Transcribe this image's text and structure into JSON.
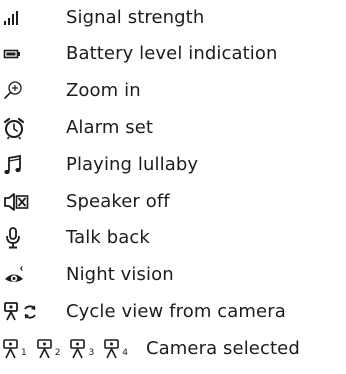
{
  "legend": {
    "items": [
      {
        "icon": "signal-strength-icon",
        "label": "Signal strength"
      },
      {
        "icon": "battery-icon",
        "label": "Battery level indication"
      },
      {
        "icon": "zoom-in-icon",
        "label": "Zoom in"
      },
      {
        "icon": "alarm-clock-icon",
        "label": "Alarm set"
      },
      {
        "icon": "music-note-icon",
        "label": "Playing lullaby"
      },
      {
        "icon": "speaker-off-icon",
        "label": "Speaker off"
      },
      {
        "icon": "microphone-icon",
        "label": "Talk back"
      },
      {
        "icon": "night-vision-icon",
        "label": "Night vision"
      },
      {
        "icon": "cycle-camera-icon",
        "label": "Cycle view from camera"
      }
    ],
    "camera_row": {
      "cameras": [
        "1",
        "2",
        "3",
        "4"
      ],
      "label": "Camera selected"
    }
  }
}
